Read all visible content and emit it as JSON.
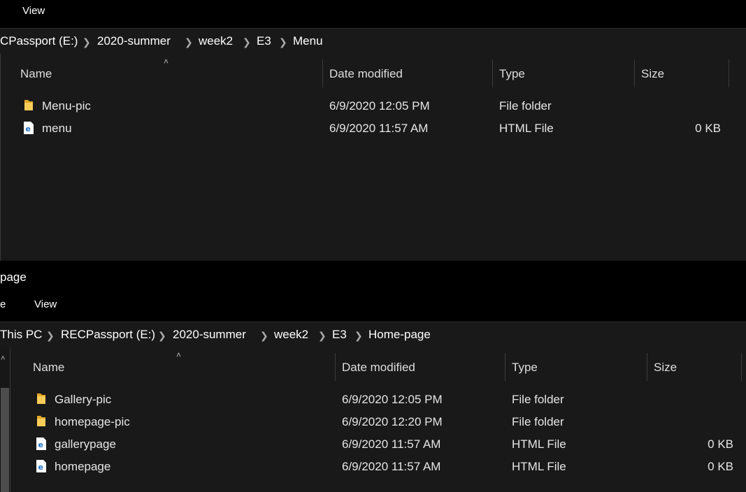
{
  "top_window": {
    "menu": {
      "view_label": "View"
    },
    "breadcrumb": [
      "CPassport (E:)",
      "2020-summer",
      "week2",
      "E3",
      "Menu"
    ],
    "columns": {
      "name": "Name",
      "date": "Date modified",
      "type": "Type",
      "size": "Size"
    },
    "rows": [
      {
        "name": "Menu-pic",
        "date": "6/9/2020 12:05 PM",
        "type": "File folder",
        "size": "",
        "icon": "folder-icon"
      },
      {
        "name": "menu",
        "date": "6/9/2020 11:57 AM",
        "type": "HTML File",
        "size": "0 KB",
        "icon": "edge-html-icon"
      }
    ]
  },
  "bottom_window": {
    "title": "page",
    "menu": {
      "file_label": "e",
      "view_label": "View"
    },
    "breadcrumb": [
      "This PC",
      "RECPassport (E:)",
      "2020-summer",
      "week2",
      "E3",
      "Home-page"
    ],
    "columns": {
      "name": "Name",
      "date": "Date modified",
      "type": "Type",
      "size": "Size"
    },
    "rows": [
      {
        "name": "Gallery-pic",
        "date": "6/9/2020 12:05 PM",
        "type": "File folder",
        "size": "",
        "icon": "folder-icon"
      },
      {
        "name": "homepage-pic",
        "date": "6/9/2020 12:20 PM",
        "type": "File folder",
        "size": "",
        "icon": "folder-icon"
      },
      {
        "name": "gallerypage",
        "date": "6/9/2020 11:57 AM",
        "type": "HTML File",
        "size": "0 KB",
        "icon": "edge-html-icon"
      },
      {
        "name": "homepage",
        "date": "6/9/2020 11:57 AM",
        "type": "HTML File",
        "size": "0 KB",
        "icon": "edge-html-icon"
      }
    ]
  },
  "colors": {
    "background": "#191919",
    "folder": "#f5c542",
    "html_icon": "#1e73c8"
  }
}
